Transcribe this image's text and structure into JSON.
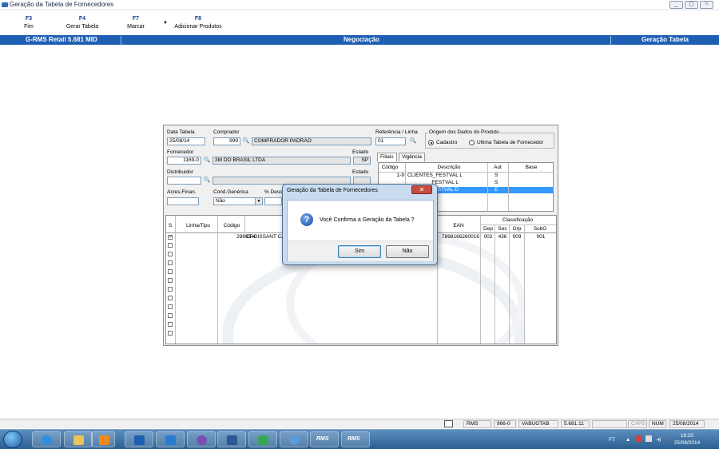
{
  "window": {
    "title": "Geração da Tabela de Fornecedores",
    "controls": [
      "_",
      "▢",
      "✕"
    ]
  },
  "toolbar": {
    "items": [
      {
        "key": "F3",
        "label": "Fim"
      },
      {
        "key": "F4",
        "label": "Gerar Tabela"
      },
      {
        "key": "F7",
        "label": "Marcar"
      },
      {
        "key": "F8",
        "label": "Adicionar Produtos"
      }
    ]
  },
  "band": {
    "app": "G-RMS Retail 5.681 MID",
    "center": "Negociação",
    "right": "Geração Tabela"
  },
  "form": {
    "data_tabela_label": "Data Tabela",
    "data_tabela": "25/08/14",
    "comprador_label": "Comprador",
    "comprador_code": "999",
    "comprador_name": "COMPRADOR PADRÃO",
    "referencia_label": "Referência / Linha",
    "referencia": "01",
    "origem_label": "Origem dos Dados do Produto",
    "origem_opt1": "Cadastro",
    "origem_opt2": "Ultima Tabela de Fornecedor",
    "fornecedor_label": "Fornecedor",
    "fornecedor_code": "1169-0",
    "fornecedor_name": "3M DO BRASIL LTDA",
    "estado_label": "Estado",
    "estado": "SP",
    "distribuidor_label": "Distribuidor",
    "distribuidor_code": "",
    "distribuidor_name": "",
    "estado2_label": "Estado",
    "acres_label": "Acres.Finan.",
    "acres": "",
    "cond_label": "Cond.Genérica",
    "cond": "Não",
    "desc_label": "% Desc"
  },
  "filiais": {
    "tabs": [
      "Filiais",
      "Vigência"
    ],
    "headers": [
      "Código",
      "Descrição",
      "Aut",
      "Base"
    ],
    "rows": [
      {
        "codigo": "1-9",
        "descricao": "CLIENTES_FESTVAL L",
        "aut": "S",
        "base": ""
      },
      {
        "codigo": "",
        "descricao": "FESTVAL L",
        "aut": "S",
        "base": ""
      },
      {
        "codigo": "",
        "descricao": "FESTVAL D",
        "aut": "E",
        "base": ""
      }
    ]
  },
  "grid": {
    "headers": {
      "s": "S",
      "linha": "Linha/Tipo",
      "codigo": "Código",
      "ean": "EAN",
      "classificacao": "Classificação",
      "dep": "Dep",
      "sec": "Sec",
      "grp": "Grp",
      "subg": "SubG"
    },
    "rows": [
      {
        "checked": "✓",
        "linha": "",
        "codigo": "28893-4",
        "descricao": "CROISSANT CA",
        "ean": "7898166260016",
        "dep": "002",
        "sec": "436",
        "grp": "009",
        "subg": "001"
      }
    ]
  },
  "dialog": {
    "title": "Geração da Tabela de Fornecedores",
    "message": "Você Confirma a Geração da Tabela ?",
    "yes": "Sim",
    "no": "Não",
    "close": "✕"
  },
  "status": {
    "rms": "RMS",
    "code": "966-0",
    "program": "VABUGTAB",
    "version": "5.681.11",
    "caps": "CAPS",
    "num": "NUM",
    "date": "25/08/2014"
  },
  "taskbar": {
    "apps": [
      "ie",
      "explorer",
      "media",
      "outlook",
      "lync",
      "pidgin",
      "word",
      "tools",
      "remote",
      "rms",
      "rms2"
    ],
    "rms_label": "RMS",
    "lang": "FT",
    "time": "16:20",
    "date": "25/08/2014"
  },
  "colors": {
    "band": "#1e5fb4",
    "selection": "#3399ff",
    "taskbar": "#2c5f91"
  }
}
